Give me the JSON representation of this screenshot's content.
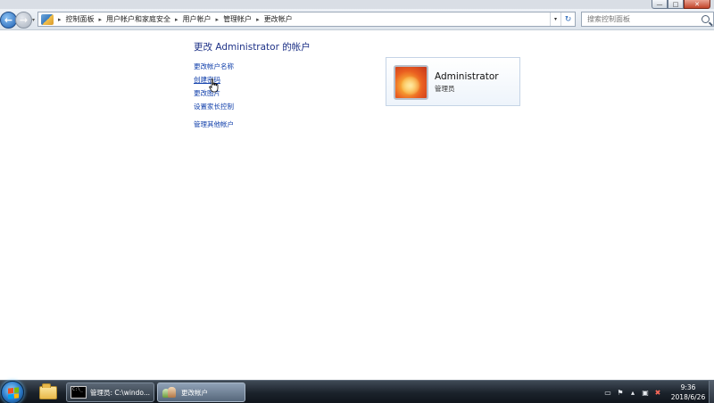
{
  "window": {
    "controls": {
      "minimize": "—",
      "maximize": "□",
      "close": "✕"
    }
  },
  "nav": {
    "back_icon": "back-arrow-icon",
    "forward_icon": "forward-arrow-icon",
    "breadcrumb": [
      "控制面板",
      "用户帐户和家庭安全",
      "用户帐户",
      "管理帐户",
      "更改帐户"
    ],
    "separator": "▸",
    "search_placeholder": "搜索控制面板"
  },
  "content": {
    "title": "更改 Administrator 的帐户",
    "tasks": [
      "更改帐户名称",
      "创建密码",
      "更改图片",
      "设置家长控制"
    ],
    "other_task": "管理其他帐户",
    "account": {
      "name": "Administrator",
      "role": "管理员"
    }
  },
  "taskbar": {
    "buttons": [
      {
        "label": "管理员: C:\\windo...",
        "icon": "cmd-icon",
        "cmd_text": "C:\\_"
      },
      {
        "label": "更改帐户",
        "icon": "control-panel-icon"
      }
    ],
    "tray_icons": [
      "keyboard-icon",
      "action-center-flag-icon",
      "notification-chevron-icon",
      "network-icon",
      "volume-muted-icon"
    ],
    "clock": {
      "time": "9:36",
      "date": "2018/6/26"
    }
  }
}
